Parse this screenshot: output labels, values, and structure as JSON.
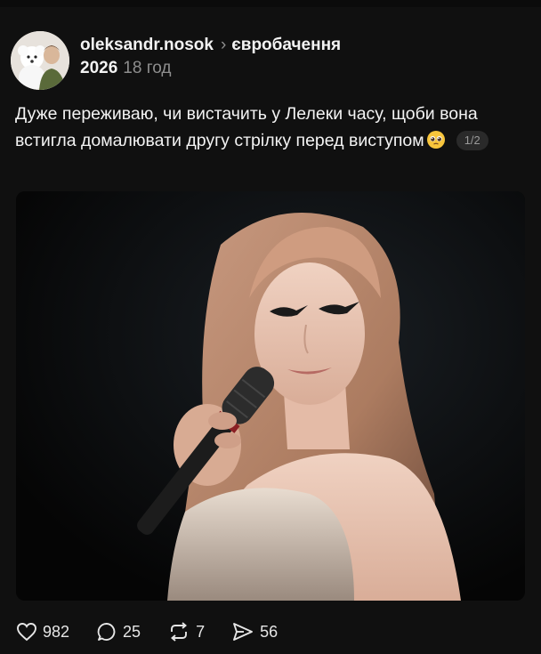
{
  "post": {
    "author": "oleksandr.nosok",
    "topic": "євробачення",
    "year": "2026",
    "time_ago": "18 год",
    "text": "Дуже переживаю, чи вистачить у Лелеки часу, щоби вона встигла домалювати другу стрілку перед виступом",
    "emoji": "pleading-face-emoji",
    "media_counter": "1/2"
  },
  "actions": {
    "likes": "982",
    "comments": "25",
    "reposts": "7",
    "shares": "56"
  },
  "colors": {
    "background": "#101010",
    "text": "#f3f3f3",
    "muted": "#8e8e8e"
  }
}
